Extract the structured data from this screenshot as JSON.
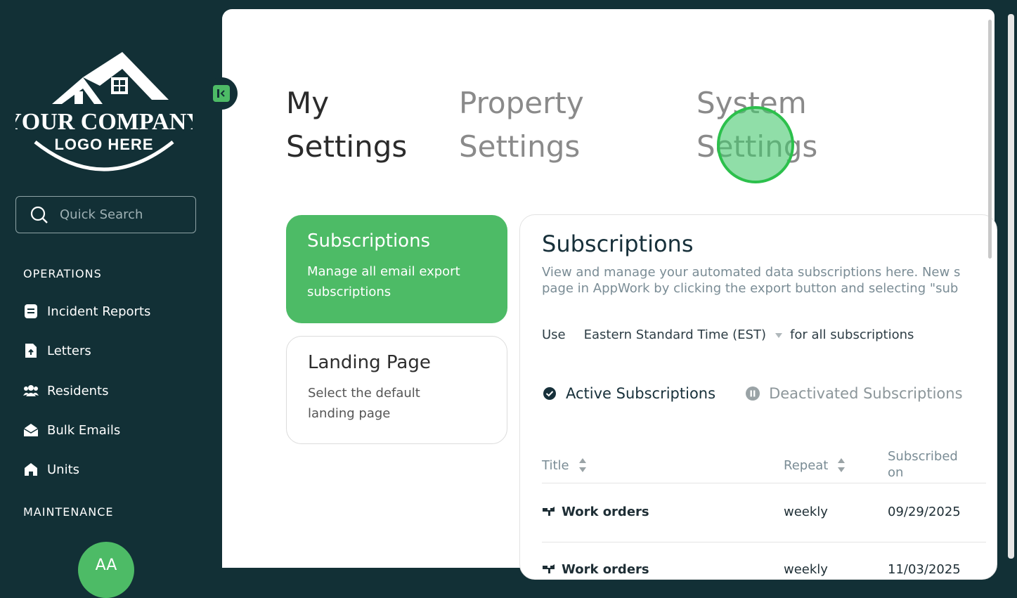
{
  "logo": {
    "line1": "YOUR COMPANY",
    "line2": "LOGO HERE"
  },
  "search": {
    "placeholder": "Quick Search"
  },
  "sidebar": {
    "operations_title": "OPERATIONS",
    "maintenance_title": "MAINTENANCE",
    "items": [
      {
        "label": "Incident Reports",
        "icon": "document-icon"
      },
      {
        "label": "Letters",
        "icon": "file-upload-icon"
      },
      {
        "label": "Residents",
        "icon": "people-icon"
      },
      {
        "label": "Bulk Emails",
        "icon": "envelope-open-icon"
      },
      {
        "label": "Units",
        "icon": "home-icon"
      }
    ],
    "avatar_initials": "AA"
  },
  "tabs": [
    {
      "label_line1": "My",
      "label_line2": "Settings",
      "active": true
    },
    {
      "label_line1": "Property",
      "label_line2": "Settings",
      "active": false
    },
    {
      "label_line1": "System",
      "label_line2": "Settings",
      "active": false
    }
  ],
  "cards": [
    {
      "title": "Subscriptions",
      "description_line1": "Manage all email export",
      "description_line2": "subscriptions",
      "selected": true
    },
    {
      "title": "Landing Page",
      "description_line1": "Select the default",
      "description_line2": "landing page",
      "selected": false
    }
  ],
  "subscriptions": {
    "title": "Subscriptions",
    "description_line1": "View and manage your automated data subscriptions here. New s",
    "description_line2": "page in AppWork by clicking the export button and selecting \"sub",
    "tz_prefix": "Use",
    "tz_value": "Eastern Standard Time (EST)",
    "tz_suffix": "for all subscriptions",
    "active_toggle": "Active Subscriptions",
    "inactive_toggle": "Deactivated Subscriptions",
    "columns": {
      "title": "Title",
      "repeat": "Repeat",
      "subscribed_line1": "Subscribed",
      "subscribed_line2": "on"
    },
    "rows": [
      {
        "title": "Work orders",
        "repeat": "weekly",
        "subscribed_on": "09/29/2025"
      },
      {
        "title": "Work orders",
        "repeat": "weekly",
        "subscribed_on": "11/03/2025"
      }
    ]
  },
  "colors": {
    "sidebar_bg": "#123036",
    "accent_green": "#4dbb66",
    "text_dark": "#17303a"
  }
}
